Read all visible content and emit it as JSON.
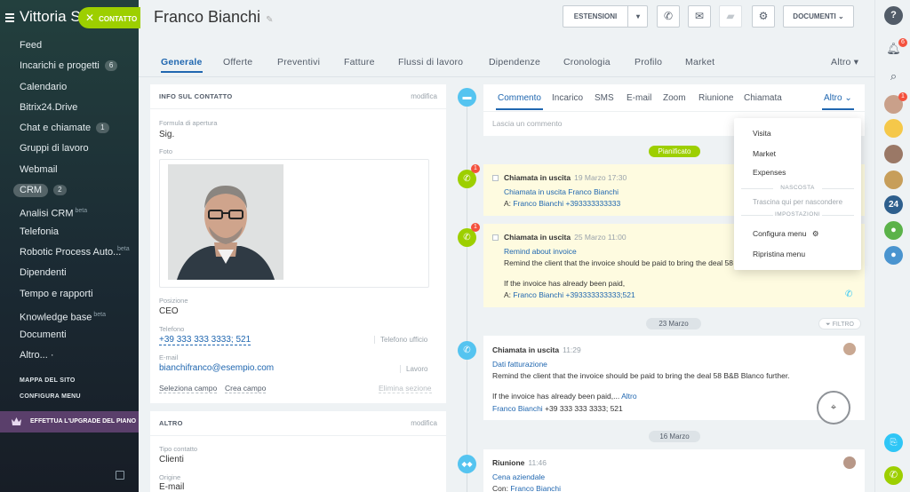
{
  "sidebar": {
    "brand": "Vittoria S",
    "contact_button": "CONTATTO",
    "items": [
      {
        "label": "Feed"
      },
      {
        "label": "Incarichi e progetti",
        "count": "6"
      },
      {
        "label": "Calendario"
      },
      {
        "label": "Bitrix24.Drive"
      },
      {
        "label": "Chat e chiamate",
        "count": "1"
      },
      {
        "label": "Gruppi di lavoro"
      },
      {
        "label": "Webmail"
      },
      {
        "label": "CRM",
        "count": "2"
      },
      {
        "label": "Analisi CRM",
        "sup": "beta"
      },
      {
        "label": "Telefonia"
      },
      {
        "label": "Robotic Process Auto...",
        "sup": "beta"
      },
      {
        "label": "Dipendenti"
      },
      {
        "label": "Tempo e rapporti"
      },
      {
        "label": "Knowledge base",
        "sup": "beta"
      },
      {
        "label": "Documenti"
      },
      {
        "label": "Altro...",
        "suffix": "·"
      }
    ],
    "site_map": "MAPPA DEL SITO",
    "configure_menu": "CONFIGURA MENU",
    "upgrade": "EFFETTUA L'UPGRADE DEL PIANO"
  },
  "header": {
    "title": "Franco Bianchi",
    "extensions_label": "ESTENSIONI",
    "documents_label": "DOCUMENTI"
  },
  "tabs": [
    {
      "label": "Generale"
    },
    {
      "label": "Offerte"
    },
    {
      "label": "Preventivi"
    },
    {
      "label": "Fatture"
    },
    {
      "label": "Flussi di lavoro"
    },
    {
      "label": "Dipendenze"
    },
    {
      "label": "Cronologia"
    },
    {
      "label": "Profilo"
    },
    {
      "label": "Market"
    },
    {
      "label": "Altro ▾"
    }
  ],
  "contact_card": {
    "heading": "INFO SUL CONTATTO",
    "edit_label": "modifica",
    "salutation_label": "Formula di apertura",
    "salutation_value": "Sig.",
    "photo_label": "Foto",
    "position_label": "Posizione",
    "position_value": "CEO",
    "phone_label": "Telefono",
    "phone_value": "+39 333 333 3333; 521",
    "phone_type": "Telefono ufficio",
    "email_label": "E-mail",
    "email_value": "bianchifranco@esempio.com",
    "email_type": "Lavoro",
    "select_field": "Seleziona campo",
    "create_field": "Crea campo",
    "delete_section": "Elimina sezione"
  },
  "other_card": {
    "heading": "ALTRO",
    "edit_label": "modifica",
    "contact_type_label": "Tipo contatto",
    "contact_type_value": "Clienti",
    "origin_label": "Origine",
    "origin_value": "E-mail"
  },
  "composer": {
    "tabs": [
      "Commento",
      "Incarico",
      "SMS",
      "E-mail",
      "Zoom",
      "Riunione",
      "Chiamata"
    ],
    "more_label": "Altro ⌄",
    "placeholder": "Lascia un commento"
  },
  "more_menu": {
    "items": [
      "Visita",
      "Market",
      "Expenses"
    ],
    "hidden_heading": "NASCOSTA",
    "hidden_hint": "Trascina qui per nascondere",
    "settings_heading": "IMPOSTAZIONI",
    "configure": "Configura menu",
    "reset": "Ripristina menu"
  },
  "timeline": {
    "planned_label": "Pianificato",
    "date_1": "23 Marzo",
    "date_2": "16 Marzo",
    "filter_label": "FILTRO",
    "entries": [
      {
        "title": "Chiamata in uscita",
        "time": "19 Marzo 17:30",
        "subject": "Chiamata in uscita Franco Bianchi",
        "to_prefix": "A:",
        "to_name": "Franco Bianchi",
        "to_phone": "+393333333333",
        "badge": "1"
      },
      {
        "title": "Chiamata in uscita",
        "time": "25 Marzo 11:00",
        "subject": "Remind about invoice",
        "text1": "Remind the client that the invoice should be paid to bring the deal 58",
        "text2": "If the invoice has already been paid,",
        "to_prefix": "A:",
        "to_name": "Franco Bianchi",
        "to_phone": "+393333333333;521",
        "badge": "1"
      },
      {
        "title": "Chiamata in uscita",
        "time": "11:29",
        "subject": "Dati fatturazione",
        "text1": "Remind the client that the invoice should be paid to bring the deal 58 B&B Blanco further.",
        "text2": "If the invoice has already been paid,...",
        "more": "Altro",
        "to_name": "Franco Bianchi",
        "to_phone": "+39 333 333 3333; 521"
      },
      {
        "title": "Riunione",
        "time": "11:46",
        "subject": "Cena aziendale",
        "to_prefix": "Con:",
        "to_name": "Franco Bianchi"
      }
    ]
  },
  "rightbar": {
    "notif_count": "6",
    "avatar_badge": "1",
    "counter_label": "24"
  },
  "colors": {
    "accent_blue": "#2067b0",
    "green": "#9dcf00",
    "badge_red": "#f4513d",
    "timeline_blue": "#55c4f0"
  }
}
